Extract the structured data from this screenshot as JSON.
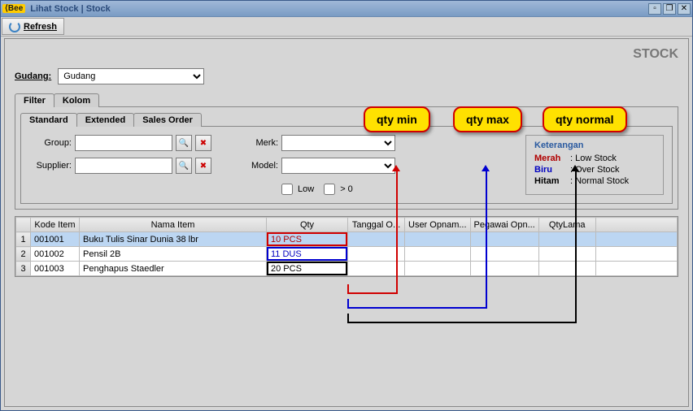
{
  "window": {
    "logo_prefix": "⟨",
    "logo_text": "Bee",
    "title": "Lihat Stock | Stock"
  },
  "toolbar": {
    "refresh_label": "Refresh"
  },
  "page": {
    "title": "STOCK"
  },
  "gudang": {
    "label": "Gudang:",
    "value": "Gudang"
  },
  "outer_tabs": {
    "filter": "Filter",
    "kolom": "Kolom"
  },
  "inner_tabs": {
    "standard": "Standard",
    "extended": "Extended",
    "sales_order": "Sales Order"
  },
  "filter": {
    "group_label": "Group:",
    "supplier_label": "Supplier:",
    "merk_label": "Merk:",
    "model_label": "Model:",
    "low_label": "Low",
    "gt0_label": "> 0"
  },
  "keterangan": {
    "title": "Keterangan",
    "rows": [
      {
        "lbl": "Merah",
        "val": ": Low Stock",
        "cls": "merah"
      },
      {
        "lbl": "Biru",
        "val": ": Over Stock",
        "cls": "biru"
      },
      {
        "lbl": "Hitam",
        "val": ": Normal Stock",
        "cls": "hitam"
      }
    ]
  },
  "grid": {
    "columns": [
      "Kode Item",
      "Nama Item",
      "Qty",
      "Tanggal O...",
      "User Opnam...",
      "Pegawai Opn...",
      "QtyLama"
    ],
    "rows": [
      {
        "n": "1",
        "kode": "001001",
        "nama": "Buku Tulis Sinar Dunia 38 lbr",
        "qty": "10 PCS",
        "qclass": "red"
      },
      {
        "n": "2",
        "kode": "001002",
        "nama": "Pensil 2B",
        "qty": "11 DUS",
        "qclass": "blue"
      },
      {
        "n": "3",
        "kode": "001003",
        "nama": "Penghapus Staedler",
        "qty": "20 PCS",
        "qclass": "black"
      }
    ]
  },
  "callouts": {
    "qty_min": "qty min",
    "qty_max": "qty max",
    "qty_normal": "qty normal"
  }
}
